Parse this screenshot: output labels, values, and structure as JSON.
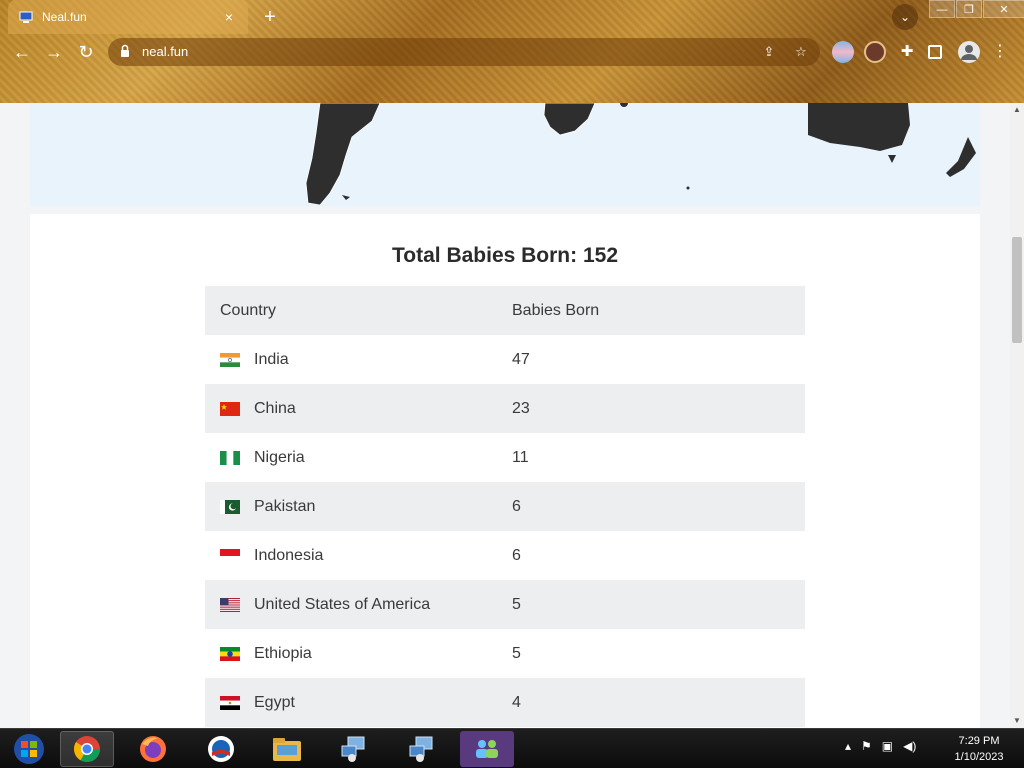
{
  "browser": {
    "tab_title": "Neal.fun",
    "tab_close": "×",
    "new_tab": "+",
    "url": "neal.fun"
  },
  "table": {
    "title": "Total Babies Born: 152",
    "columns": [
      "Country",
      "Babies Born"
    ],
    "rows": [
      {
        "country": "India",
        "count": "47",
        "flag": "india-flag"
      },
      {
        "country": "China",
        "count": "23",
        "flag": "china-flag"
      },
      {
        "country": "Nigeria",
        "count": "11",
        "flag": "nigeria-flag"
      },
      {
        "country": "Pakistan",
        "count": "6",
        "flag": "pakistan-flag"
      },
      {
        "country": "Indonesia",
        "count": "6",
        "flag": "indonesia-flag"
      },
      {
        "country": "United States of America",
        "count": "5",
        "flag": "usa-flag"
      },
      {
        "country": "Ethiopia",
        "count": "5",
        "flag": "ethiopia-flag"
      },
      {
        "country": "Egypt",
        "count": "4",
        "flag": "egypt-flag"
      }
    ]
  },
  "taskbar": {
    "time": "7:29 PM",
    "date": "1/10/2023"
  }
}
